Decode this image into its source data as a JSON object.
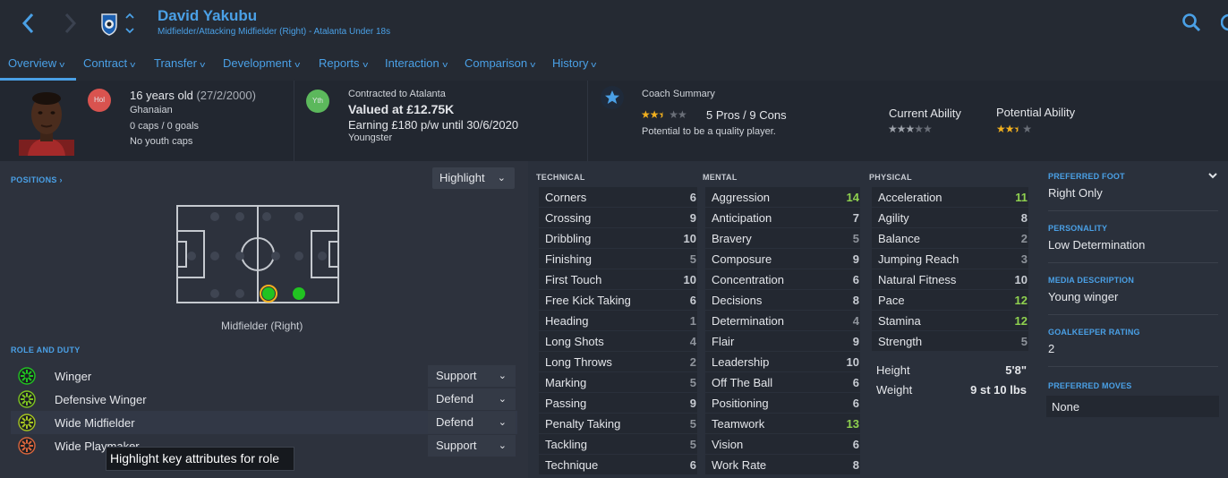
{
  "header": {
    "name": "David Yakubu",
    "subtitle": "Midfielder/Attacking Midfielder (Right) - Atalanta Under 18s",
    "icons": [
      "back-arrow-icon",
      "forward-arrow-icon",
      "club-crest-icon",
      "up-down-chevron-icon",
      "search-icon"
    ]
  },
  "tabs": [
    {
      "label": "Overview"
    },
    {
      "label": "Contract"
    },
    {
      "label": "Transfer"
    },
    {
      "label": "Development"
    },
    {
      "label": "Reports"
    },
    {
      "label": "Interaction"
    },
    {
      "label": "Comparison"
    },
    {
      "label": "History"
    }
  ],
  "info": {
    "hol_badge": "Hol",
    "age": "16 years old",
    "dob": "(27/2/2000)",
    "nationality": "Ghanaian",
    "caps": "0 caps / 0 goals",
    "youth_caps": "No youth caps",
    "yth_badge": "Yth",
    "contracted": "Contracted to Atalanta",
    "value": "Valued at £12.75K",
    "earning": "Earning £180 p/w until 30/6/2020",
    "contract_type": "Youngster",
    "coach_title": "Coach Summary",
    "coach_stars": 2.5,
    "pros_cons": "5 Pros / 9 Cons",
    "coach_text": "Potential to be a quality player.",
    "current_label": "Current Ability",
    "current_stars": 3.0,
    "potential_label": "Potential Ability",
    "potential_stars": 2.5,
    "colors": {
      "hol": "#d9534f",
      "yth": "#5cb85c",
      "star": "#f2b01e",
      "accent": "#4aa0e6"
    }
  },
  "positions": {
    "label": "POSITIONS",
    "highlight_dd": "Highlight",
    "position_text": "Midfielder (Right)"
  },
  "roles": {
    "label": "ROLE AND DUTY",
    "items": [
      {
        "name": "Winger",
        "duty": "Support"
      },
      {
        "name": "Defensive Winger",
        "duty": "Defend"
      },
      {
        "name": "Wide Midfielder",
        "duty": "Defend"
      },
      {
        "name": "Wide Playmaker",
        "duty": "Support"
      }
    ],
    "tooltip": "Highlight key attributes for role"
  },
  "attributes": {
    "technical_label": "TECHNICAL",
    "mental_label": "MENTAL",
    "physical_label": "PHYSICAL",
    "technical": [
      {
        "name": "Corners",
        "value": "6"
      },
      {
        "name": "Crossing",
        "value": "9"
      },
      {
        "name": "Dribbling",
        "value": "10"
      },
      {
        "name": "Finishing",
        "value": "5"
      },
      {
        "name": "First Touch",
        "value": "10"
      },
      {
        "name": "Free Kick Taking",
        "value": "6"
      },
      {
        "name": "Heading",
        "value": "1"
      },
      {
        "name": "Long Shots",
        "value": "4"
      },
      {
        "name": "Long Throws",
        "value": "2"
      },
      {
        "name": "Marking",
        "value": "5"
      },
      {
        "name": "Passing",
        "value": "9"
      },
      {
        "name": "Penalty Taking",
        "value": "5"
      },
      {
        "name": "Tackling",
        "value": "5"
      },
      {
        "name": "Technique",
        "value": "6"
      }
    ],
    "mental": [
      {
        "name": "Aggression",
        "value": "14"
      },
      {
        "name": "Anticipation",
        "value": "7"
      },
      {
        "name": "Bravery",
        "value": "5"
      },
      {
        "name": "Composure",
        "value": "9"
      },
      {
        "name": "Concentration",
        "value": "6"
      },
      {
        "name": "Decisions",
        "value": "8"
      },
      {
        "name": "Determination",
        "value": "4"
      },
      {
        "name": "Flair",
        "value": "9"
      },
      {
        "name": "Leadership",
        "value": "10"
      },
      {
        "name": "Off The Ball",
        "value": "6"
      },
      {
        "name": "Positioning",
        "value": "6"
      },
      {
        "name": "Teamwork",
        "value": "13"
      },
      {
        "name": "Vision",
        "value": "6"
      },
      {
        "name": "Work Rate",
        "value": "8"
      }
    ],
    "physical": [
      {
        "name": "Acceleration",
        "value": "11"
      },
      {
        "name": "Agility",
        "value": "8"
      },
      {
        "name": "Balance",
        "value": "2"
      },
      {
        "name": "Jumping Reach",
        "value": "3"
      },
      {
        "name": "Natural Fitness",
        "value": "10"
      },
      {
        "name": "Pace",
        "value": "12"
      },
      {
        "name": "Stamina",
        "value": "12"
      },
      {
        "name": "Strength",
        "value": "5"
      }
    ],
    "height_label": "Height",
    "height": "5'8\"",
    "weight_label": "Weight",
    "weight": "9 st 10 lbs"
  },
  "profile": {
    "foot_label": "PREFERRED FOOT",
    "foot": "Right Only",
    "personality_label": "PERSONALITY",
    "personality": "Low Determination",
    "media_label": "MEDIA DESCRIPTION",
    "media": "Young winger",
    "gk_label": "GOALKEEPER RATING",
    "gk": "2",
    "moves_label": "PREFERRED MOVES",
    "moves": "None"
  }
}
